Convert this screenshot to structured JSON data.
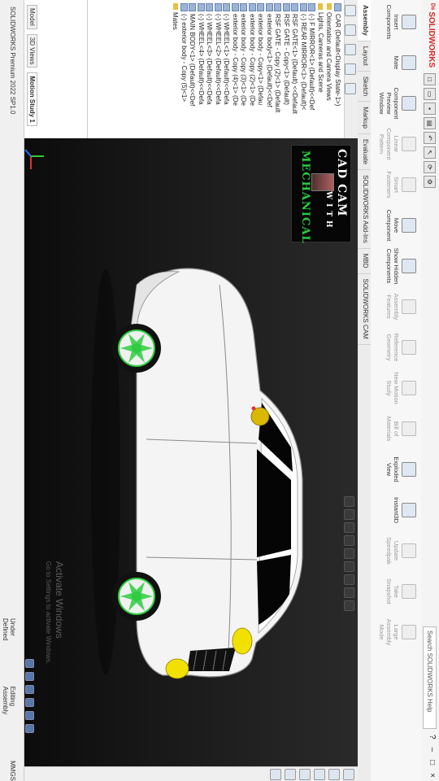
{
  "app": {
    "brand": "SOLIDWORKS",
    "search_placeholder": "Search SOLIDWORKS Help",
    "window_controls": [
      "?",
      "–",
      "□",
      "×"
    ]
  },
  "ribbon": {
    "buttons": [
      {
        "label": "Insert Components",
        "dim": false
      },
      {
        "label": "Mate",
        "dim": false
      },
      {
        "label": "Component Preview Window",
        "dim": false
      },
      {
        "label": "Linear Component Pattern",
        "dim": true
      },
      {
        "label": "Smart Fasteners",
        "dim": true
      },
      {
        "label": "Move Component",
        "dim": false
      },
      {
        "label": "Show Hidden Components",
        "dim": false
      },
      {
        "label": "Assembly Features",
        "dim": true
      },
      {
        "label": "Reference Geometry",
        "dim": true
      },
      {
        "label": "New Motion Study",
        "dim": true
      },
      {
        "label": "Bill of Materials",
        "dim": true
      },
      {
        "label": "Exploded View",
        "dim": false
      },
      {
        "label": "Instant3D",
        "dim": false
      },
      {
        "label": "Update Speedpak",
        "dim": true
      },
      {
        "label": "Take Snapshot",
        "dim": true
      },
      {
        "label": "Large Assembly Mode",
        "dim": true
      }
    ]
  },
  "tabs": [
    "Assembly",
    "Layout",
    "Sketch",
    "Markup",
    "Evaluate",
    "SOLIDWORKS Add-Ins",
    "MBD",
    "SOLIDWORKS CAM"
  ],
  "active_tab": 0,
  "feature_tree": {
    "items": [
      {
        "icon": "part",
        "label": "CAR (Default<Display State-1>)"
      },
      {
        "icon": "folder",
        "label": "Orientation and Camera Views"
      },
      {
        "icon": "folder",
        "label": "Lights, Cameras and Scene"
      },
      {
        "icon": "part",
        "label": "(-) F MIRROR<1> (Default)<<Def"
      },
      {
        "icon": "part",
        "label": "(-) REAR MIRROR<1> (Default)<"
      },
      {
        "icon": "part",
        "label": "RSF GATE<1> (Default) <<Default"
      },
      {
        "icon": "part",
        "label": "RSF GATE - Copy<1> (Default)"
      },
      {
        "icon": "part",
        "label": "RSF GATE - Copy (2)<1> (Default"
      },
      {
        "icon": "part",
        "label": "exterior body<1> (Default)<<Def"
      },
      {
        "icon": "part",
        "label": "exterior body - Copy<1> (Defau"
      },
      {
        "icon": "part",
        "label": "exterior body - Copy (2)<1> (De"
      },
      {
        "icon": "part",
        "label": "exterior body - Copy (3)<1> (De"
      },
      {
        "icon": "part",
        "label": "exterior body - Copy (4)<1> (De"
      },
      {
        "icon": "part",
        "label": "(-) WHEEL<1> (Default)<<Defa"
      },
      {
        "icon": "part",
        "label": "(-) WHEEL<2> (Default)<<Defa"
      },
      {
        "icon": "part",
        "label": "(-) WHEEL<3> (Default)<<Defa"
      },
      {
        "icon": "part",
        "label": "(-) WHEEL<4> (Default)<<Defa"
      },
      {
        "icon": "part",
        "label": "MAIN BODY<1> (Default)<<Def"
      },
      {
        "icon": "part",
        "label": "(-) exterior body - Copy (5)<1>"
      },
      {
        "icon": "folder",
        "label": "Mates"
      }
    ]
  },
  "motion": {
    "tabs": [
      "Model",
      "3D Views",
      "Motion Study 1"
    ],
    "active": 2
  },
  "status": {
    "left": "SOLIDWORKS Premium 2022 SP1.0",
    "right": [
      "Under Defined",
      "Editing Assembly",
      "MMGS"
    ]
  },
  "banner": {
    "line1": "CAD CAM",
    "line2": "WITH",
    "line3": "MECHANICAL"
  },
  "watermark": {
    "title": "Activate Windows",
    "subtitle": "Go to Settings to activate Windows."
  },
  "colors": {
    "car_body": "#f4f4f4",
    "accent_yellow": "#f2e000",
    "rim_green": "#2ecc40",
    "banner_green": "#2ecc40",
    "viewport_bg": "#1d1d1d"
  }
}
